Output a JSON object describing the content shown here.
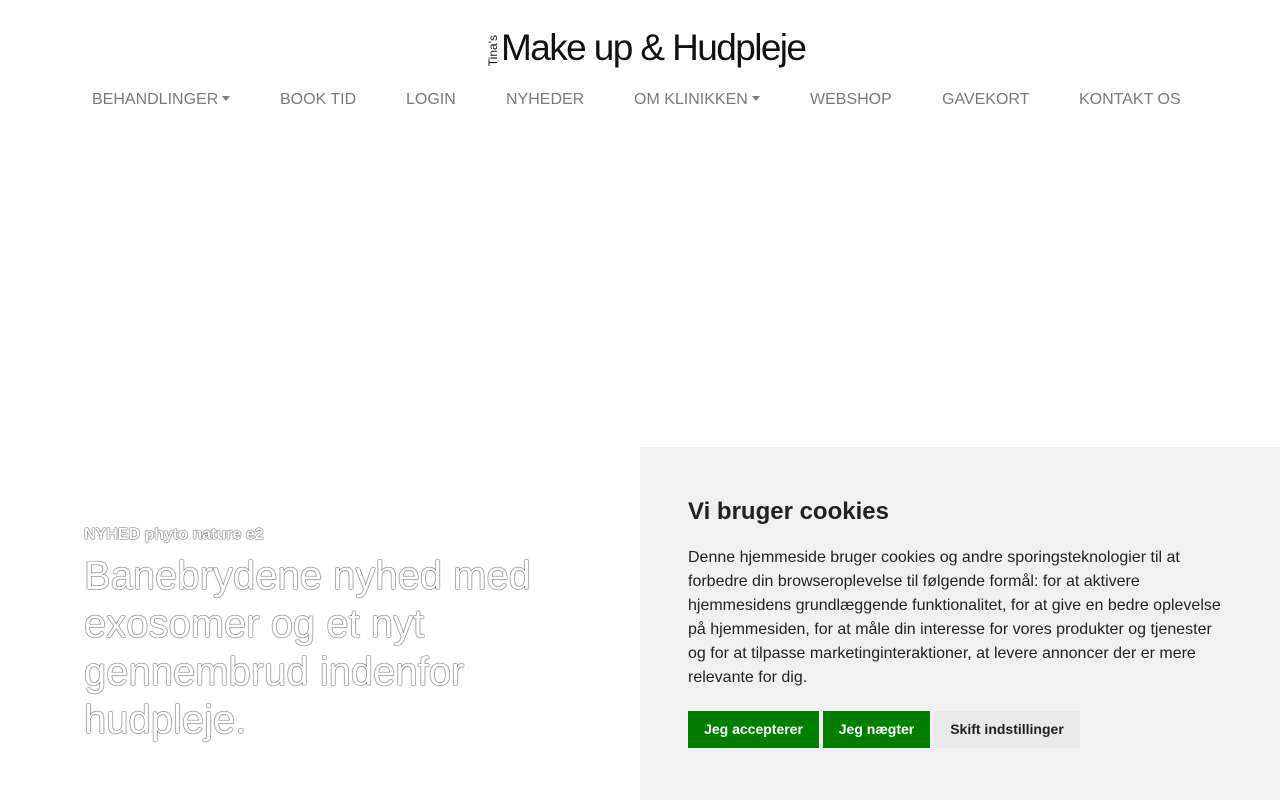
{
  "header": {
    "logo_small": "Tina's",
    "logo_main": "Make up & Hudpleje"
  },
  "nav": {
    "items": [
      {
        "label": "BEHANDLINGER",
        "dropdown": true
      },
      {
        "label": "BOOK TID",
        "dropdown": false
      },
      {
        "label": "LOGIN",
        "dropdown": false
      },
      {
        "label": "NYHEDER",
        "dropdown": false
      },
      {
        "label": "OM KLINIKKEN",
        "dropdown": true
      },
      {
        "label": "WEBSHOP",
        "dropdown": false
      },
      {
        "label": "GAVEKORT",
        "dropdown": false
      },
      {
        "label": "KONTAKT OS",
        "dropdown": false
      }
    ]
  },
  "hero": {
    "kicker": "NYHED phyto nature e2",
    "title": "Banebrydene nyhed med exosomer og et nyt gennembrud indenfor hudpleje."
  },
  "cookie": {
    "title": "Vi bruger cookies",
    "text": "Denne hjemmeside bruger cookies og andre sporingsteknologier til at forbedre din browseroplevelse til følgende formål: for at aktivere hjemmesidens grundlæggende funktionalitet, for at give en bedre oplevelse på hjemmesiden, for at måle din interesse for vores produkter og tjenester og for at tilpasse marketinginteraktioner, at levere annoncer der er mere relevante for dig.",
    "accept_label": "Jeg accepterer",
    "reject_label": "Jeg nægter",
    "settings_label": "Skift indstillinger"
  },
  "colors": {
    "nav_text": "#7b7b7b",
    "cookie_bg": "#f1f1f1",
    "button_green": "#008000",
    "button_grey": "#e9e9e9"
  }
}
